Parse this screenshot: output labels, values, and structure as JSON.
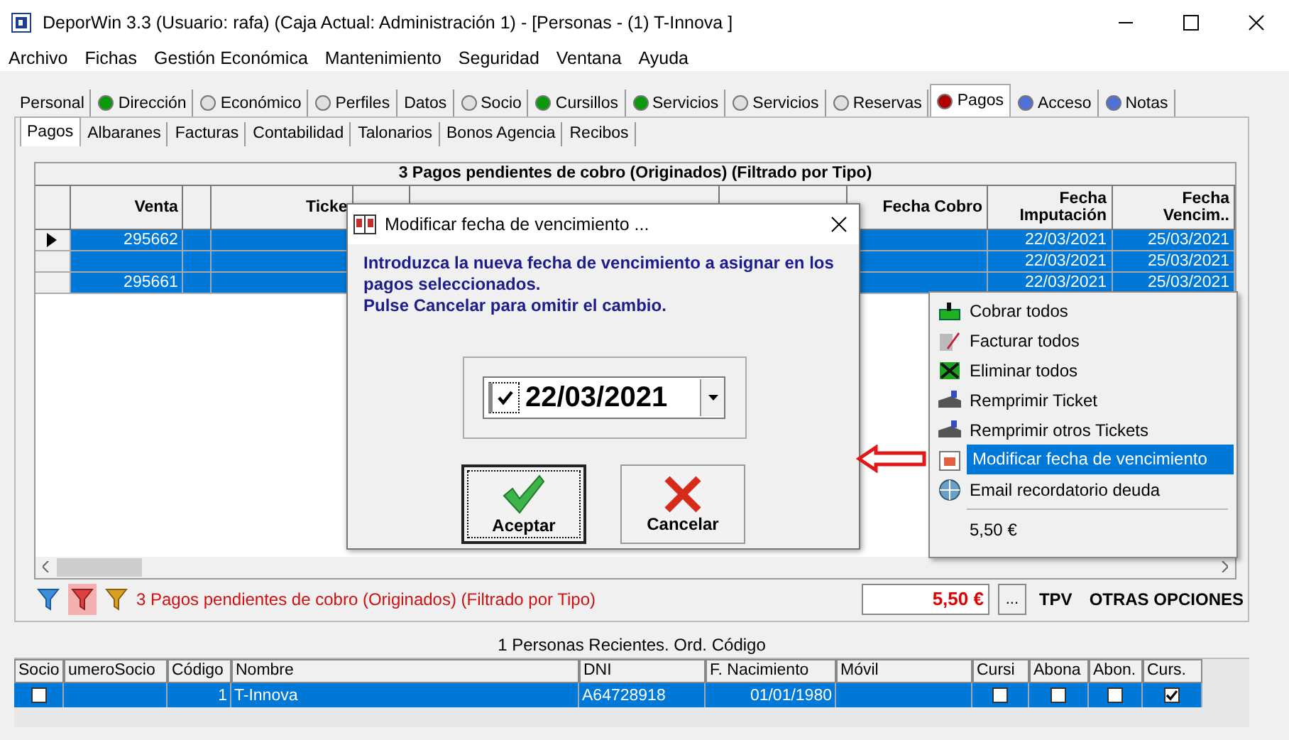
{
  "window": {
    "title": "DeporWin 3.3  (Usuario: rafa)  (Caja Actual: Administración 1) - [Personas - (1) T-Innova  ]"
  },
  "menu": [
    "Archivo",
    "Fichas",
    "Gestión Económica",
    "Mantenimiento",
    "Seguridad",
    "Ventana",
    "Ayuda"
  ],
  "tabs": [
    {
      "label": "Personal",
      "selected": false
    },
    {
      "label": "Dirección",
      "selected": false,
      "color": "#0a9a0a"
    },
    {
      "label": "Económico",
      "selected": false,
      "color": "#e0e0e0"
    },
    {
      "label": "Perfiles",
      "selected": false,
      "color": "#e0e0e0"
    },
    {
      "label": "Datos",
      "selected": false
    },
    {
      "label": "Socio",
      "selected": false,
      "color": "#e0e0e0"
    },
    {
      "label": "Cursillos",
      "selected": false,
      "color": "#0a9a0a"
    },
    {
      "label": "Servicios",
      "selected": false,
      "color": "#0a9a0a"
    },
    {
      "label": "Servicios",
      "selected": false,
      "color": "#e0e0e0"
    },
    {
      "label": "Reservas",
      "selected": false,
      "color": "#e0e0e0"
    },
    {
      "label": "Pagos",
      "selected": true,
      "color": "#b00000"
    },
    {
      "label": "Acceso",
      "selected": false,
      "color": "#5070d8"
    },
    {
      "label": "Notas",
      "selected": false,
      "color": "#5070d8"
    }
  ],
  "subtabs": [
    {
      "label": "Pagos",
      "selected": true
    },
    {
      "label": "Albaranes",
      "selected": false
    },
    {
      "label": "Facturas",
      "selected": false
    },
    {
      "label": "Contabilidad",
      "selected": false
    },
    {
      "label": "Talonarios",
      "selected": false
    },
    {
      "label": "Bonos Agencia",
      "selected": false
    },
    {
      "label": "Recibos",
      "selected": false
    }
  ],
  "grid": {
    "title": "3 Pagos pendientes de cobro (Originados) (Filtrado por Tipo)",
    "columns": [
      "Venta",
      "Ticke",
      "Fecha Cobro",
      "Fecha Imputación",
      "Fecha Vencim.."
    ],
    "rows": [
      {
        "current": true,
        "selected": true,
        "venta": "295662",
        "fecha_imputacion": "22/03/2021",
        "fecha_vencimiento": "25/03/2021"
      },
      {
        "current": false,
        "selected": true,
        "fecha_imputacion": "22/03/2021",
        "fecha_vencimiento": "25/03/2021"
      },
      {
        "current": false,
        "selected": true,
        "venta": "295661",
        "fecha_imputacion": "22/03/2021",
        "fecha_vencimiento": "25/03/2021"
      }
    ]
  },
  "status": {
    "text": "3 Pagos pendientes de cobro (Originados) (Filtrado por Tipo)",
    "amount": "5,50 €",
    "more": "...",
    "tpv": "TPV",
    "options": "OTRAS OPCIONES"
  },
  "dialog": {
    "title": "Modificar fecha de vencimiento ...",
    "message": "Introduzca la nueva fecha de vencimiento a asignar en los pagos seleccionados.",
    "hint": "Pulse Cancelar para omitir el cambio.",
    "date": {
      "checked": true,
      "value": "22/03/2021"
    },
    "buttons": [
      {
        "label": "Aceptar",
        "kind": "ok"
      },
      {
        "label": "Cancelar",
        "kind": "cancel"
      }
    ]
  },
  "context_menu": [
    {
      "label": "Cobrar todos",
      "kind": "action",
      "selected": false
    },
    {
      "label": "Facturar todos",
      "kind": "action",
      "selected": false
    },
    {
      "label": "Eliminar todos",
      "kind": "action",
      "selected": false
    },
    {
      "label": "Remprimir Ticket",
      "kind": "action",
      "selected": false
    },
    {
      "label": "Remprimir otros Tickets",
      "kind": "action",
      "selected": false
    },
    {
      "label": "Modificar fecha de vencimiento",
      "kind": "action",
      "selected": true
    },
    {
      "label": "Email recordatorio deuda",
      "kind": "action",
      "selected": false
    },
    {
      "label": "5,50 €",
      "kind": "total",
      "selected": false
    }
  ],
  "recent": {
    "title": "1 Personas Recientes. Ord. Código",
    "columns": [
      "Socio",
      "umeroSocio",
      "Código",
      "Nombre",
      "DNI",
      "F. Nacimiento",
      "Móvil",
      "Cursi",
      "Abona",
      "Abon.",
      "Curs."
    ],
    "rows": [
      {
        "selected": true,
        "socio": false,
        "codigo": "1",
        "nombre": "T-Innova",
        "dni": "A64728918",
        "nacimiento": "01/01/1980",
        "cursi": false,
        "abona": false,
        "abon": false,
        "curs": true
      }
    ]
  }
}
